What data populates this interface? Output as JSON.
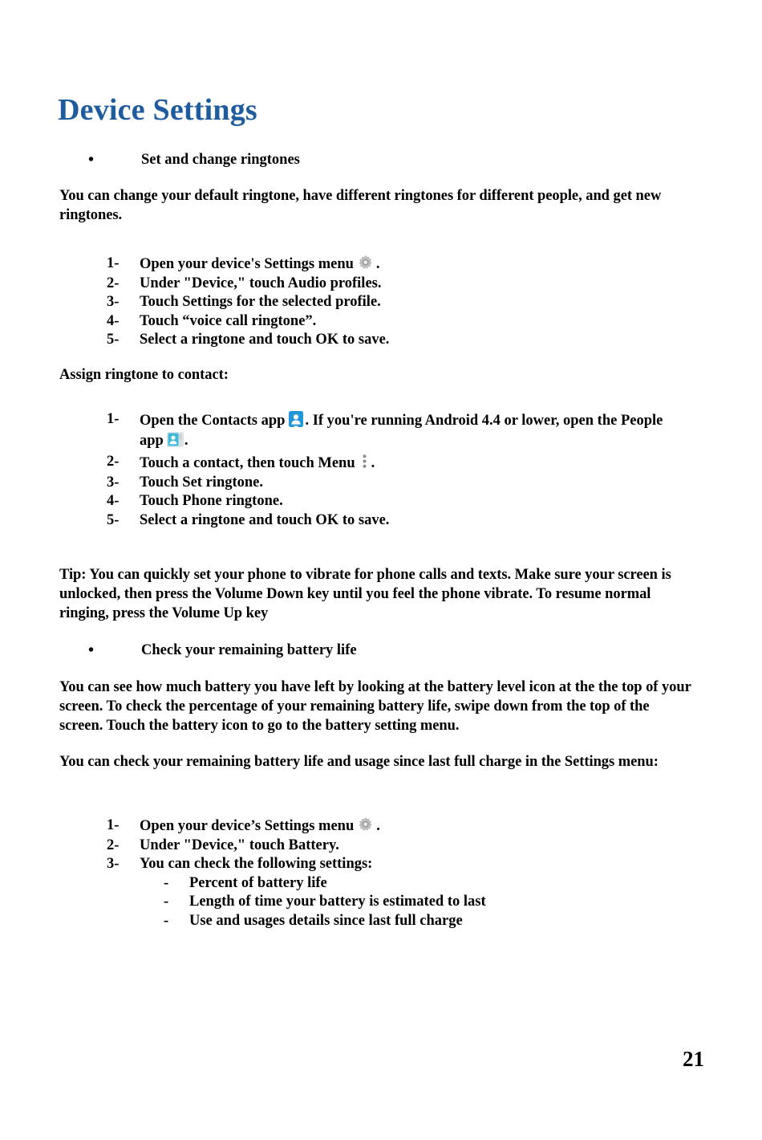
{
  "document": {
    "title": "Device Settings",
    "title_color": "#1f5c9e",
    "page_number": "21"
  },
  "section_ringtones": {
    "bullet": "Set and change ringtones",
    "intro": "You can change your default ringtone, have different ringtones for different people, and get new ringtones.",
    "steps": [
      {
        "num": "1-",
        "text_before": "Open your device's Settings menu",
        "icon": "gear-icon",
        "text_after": "."
      },
      {
        "num": "2-",
        "text_before": "Under \"Device,\" touch Audio profiles.",
        "icon": "",
        "text_after": ""
      },
      {
        "num": "3-",
        "text_before": "Touch Settings for the selected profile.",
        "icon": "",
        "text_after": ""
      },
      {
        "num": "4-",
        "text_before": "Touch “voice call ringtone”.",
        "icon": "",
        "text_after": ""
      },
      {
        "num": "5-",
        "text_before": "Select a ringtone and touch OK to save.",
        "icon": "",
        "text_after": ""
      }
    ]
  },
  "section_assign": {
    "heading": "Assign ringtone to contact:",
    "step1_num": "1-",
    "step1_part1": "Open the Contacts app",
    "step1_part2": ". If you're running Android 4.4 or lower, open the People app",
    "step1_part3": ".",
    "step1_icon1": "contacts-app-icon",
    "step1_icon2": "people-app-icon",
    "step2_num": "2-",
    "step2_part1": "Touch a contact, then touch Menu",
    "step2_icon": "kebab-menu-icon",
    "step2_part2": ".",
    "steps_rest": [
      {
        "num": "3-",
        "text": "Touch Set ringtone."
      },
      {
        "num": "4-",
        "text": "Touch Phone ringtone."
      },
      {
        "num": "5-",
        "text": "Select a ringtone and touch OK to save."
      }
    ]
  },
  "tip": {
    "text": "Tip: You can quickly set your phone to vibrate for phone calls and texts. Make sure your screen is unlocked, then press the Volume Down key until you feel the phone vibrate. To resume normal ringing, press the Volume Up key"
  },
  "section_battery": {
    "bullet": "Check your remaining battery life",
    "para1": "You can see how much battery you have left by looking at the battery level icon at the the top of your screen. To check the percentage of your remaining battery life, swipe down from the top of the screen. Touch the battery icon to go to the battery setting menu.",
    "para2": "You can check your remaining battery life and usage since last full charge in the Settings menu:",
    "step1_num": "1-",
    "step1_part1": "Open your device’s Settings menu",
    "step1_icon": "gear-icon",
    "step1_part2": ".",
    "step2_num": "2-",
    "step2_text": "Under \"Device,\" touch Battery.",
    "step3_num": "3-",
    "step3_text": "You can check the following settings:",
    "sub_items": [
      {
        "dash": "-",
        "text": "Percent of battery life"
      },
      {
        "dash": "-",
        "text": "Length of time your battery is estimated to last"
      },
      {
        "dash": "-",
        "text": "Use and usages details since last full charge"
      }
    ]
  },
  "icons": {
    "bullet_glyph": "•",
    "gear_color": "#b6b6b6",
    "contacts_blue": "#2196d9",
    "people_teal": "#3fb8d8",
    "kebab_gray": "#8a8a8a"
  }
}
